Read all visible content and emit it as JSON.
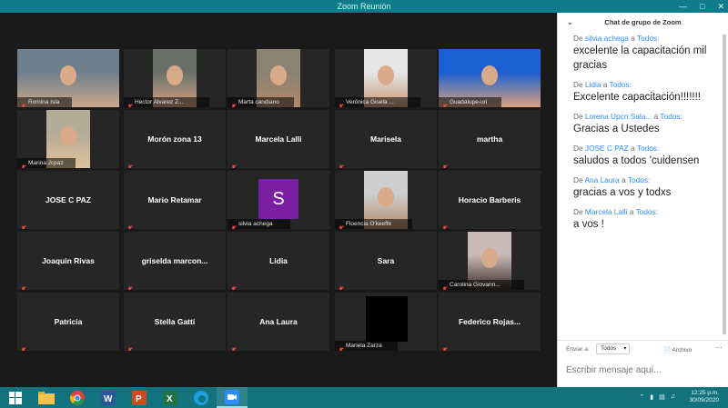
{
  "window": {
    "title": "Zoom Reunión"
  },
  "participants": [
    {
      "name": "Romina Isla",
      "video": true
    },
    {
      "name": "Hector Alvarez Z...",
      "video": true
    },
    {
      "name": "Marta candiano",
      "video": true
    },
    {
      "name": "Verónica Gisela ...",
      "video": true
    },
    {
      "name": "Guadalupe-uri",
      "video": true
    },
    {
      "name": "Marina Jcpaz",
      "video": true
    },
    {
      "name": "Morón zona 13",
      "video": false
    },
    {
      "name": "Marcela Lalli",
      "video": false
    },
    {
      "name": "Marisela",
      "video": false
    },
    {
      "name": "martha",
      "video": false
    },
    {
      "name": "JOSE C PAZ",
      "video": false
    },
    {
      "name": "Mario Retamar",
      "video": false
    },
    {
      "name": "silvia achega",
      "video": false,
      "initial": "S"
    },
    {
      "name": "Floencia O'keeffe",
      "video": true
    },
    {
      "name": "Horacio Barberis",
      "video": false
    },
    {
      "name": "Joaquin Rivas",
      "video": false
    },
    {
      "name": "griselda  marcon...",
      "video": false
    },
    {
      "name": "Lidia",
      "video": false
    },
    {
      "name": "Sara",
      "video": false
    },
    {
      "name": "Carolina Giovann...",
      "video": true
    },
    {
      "name": "Patricia",
      "video": false
    },
    {
      "name": "Stella Gatti",
      "video": false
    },
    {
      "name": "Ana Laura",
      "video": false
    },
    {
      "name": "Mariela Zarza",
      "video": true,
      "black": true
    },
    {
      "name": "Federico  Rojas...",
      "video": false
    }
  ],
  "chat": {
    "title": "Chat de grupo de Zoom",
    "prefix_de": "De",
    "prefix_a": "a",
    "messages": [
      {
        "sender": "silvia achega",
        "to": "Todos:",
        "text": "excelente la capacitación mil gracias"
      },
      {
        "sender": "Lidia",
        "to": "Todos:",
        "text": "Excelente capacitación!!!!!!!"
      },
      {
        "sender": "Lorena Upcn Sala...",
        "to": "Todos:",
        "text": "Gracias a Ustedes"
      },
      {
        "sender": "JOSE C PAZ",
        "to": "Todos:",
        "text": "saludos a todos 'cuidensen"
      },
      {
        "sender": "Ana Laura",
        "to": "Todos:",
        "text": "gracias a vos y todxs"
      },
      {
        "sender": "Marcela Lalli",
        "to": "Todos:",
        "text": "a vos !"
      }
    ],
    "send_to_label": "Enviar a:",
    "send_to_value": "Todos",
    "file_label": "Archivo",
    "input_placeholder": "Escribir mensaje aquí..."
  },
  "taskbar": {
    "time": "12:25 p.m.",
    "date": "30/09/2020"
  },
  "colors": {
    "titlebar": "#0f7c8c",
    "taskbar": "#12727e",
    "accent": "#2d8cff",
    "avatar": "#7b1fa2"
  }
}
